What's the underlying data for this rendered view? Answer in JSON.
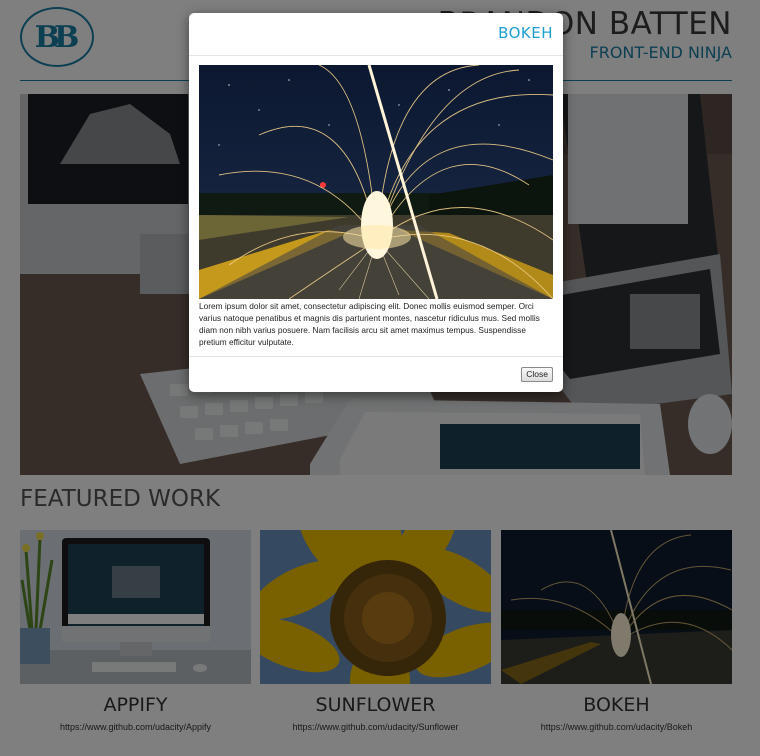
{
  "header": {
    "logo_text": "BB",
    "site_name": "BRANDON BATTEN",
    "tagline": "FRONT-END NINJA"
  },
  "featured": {
    "heading": "FEATURED WORK",
    "items": [
      {
        "title": "APPIFY",
        "link": "https://www.github.com/udacity/Appify"
      },
      {
        "title": "SUNFLOWER",
        "link": "https://www.github.com/udacity/Sunflower"
      },
      {
        "title": "BOKEH",
        "link": "https://www.github.com/udacity/Bokeh"
      }
    ]
  },
  "modal": {
    "title": "BOKEH",
    "description": "Lorem ipsum dolor sit amet, consectetur adipiscing elit. Donec mollis euismod semper. Orci varius natoque penatibus et magnis dis parturient montes, nascetur ridiculus mus. Sed mollis diam non nibh varius posuere. Nam facilisis arcu sit amet maximus tempus. Suspendisse pretium efficitur vulputate.",
    "close_label": "Close"
  },
  "colors": {
    "accent": "#1b7fa6",
    "modal_title": "#1b9fd0",
    "overlay": "rgba(0,0,0,0.5)"
  }
}
